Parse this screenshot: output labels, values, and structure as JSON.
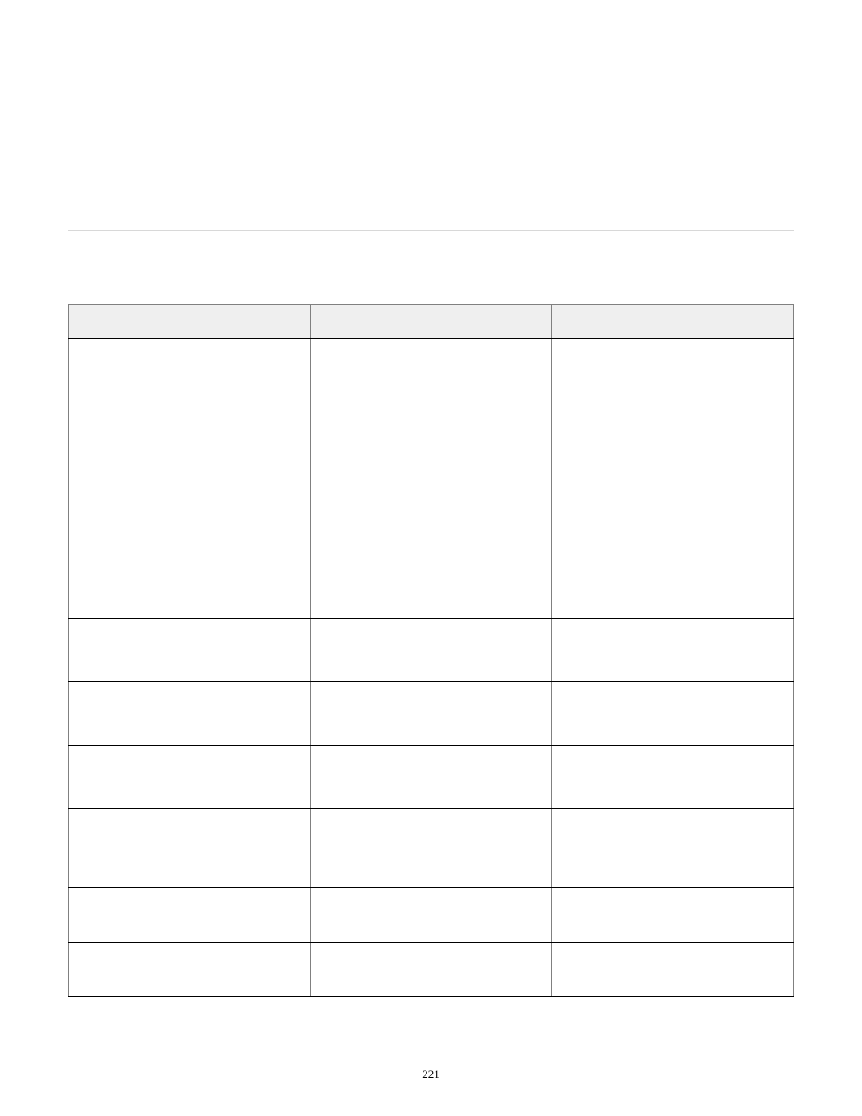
{
  "page_number": "221",
  "table": {
    "headers": [
      "",
      "",
      ""
    ],
    "rows": [
      [
        "",
        "",
        ""
      ],
      [
        "",
        "",
        ""
      ],
      [
        "",
        "",
        ""
      ],
      [
        "",
        "",
        ""
      ],
      [
        "",
        "",
        ""
      ],
      [
        "",
        "",
        ""
      ],
      [
        "",
        "",
        ""
      ],
      [
        "",
        "",
        ""
      ]
    ]
  }
}
